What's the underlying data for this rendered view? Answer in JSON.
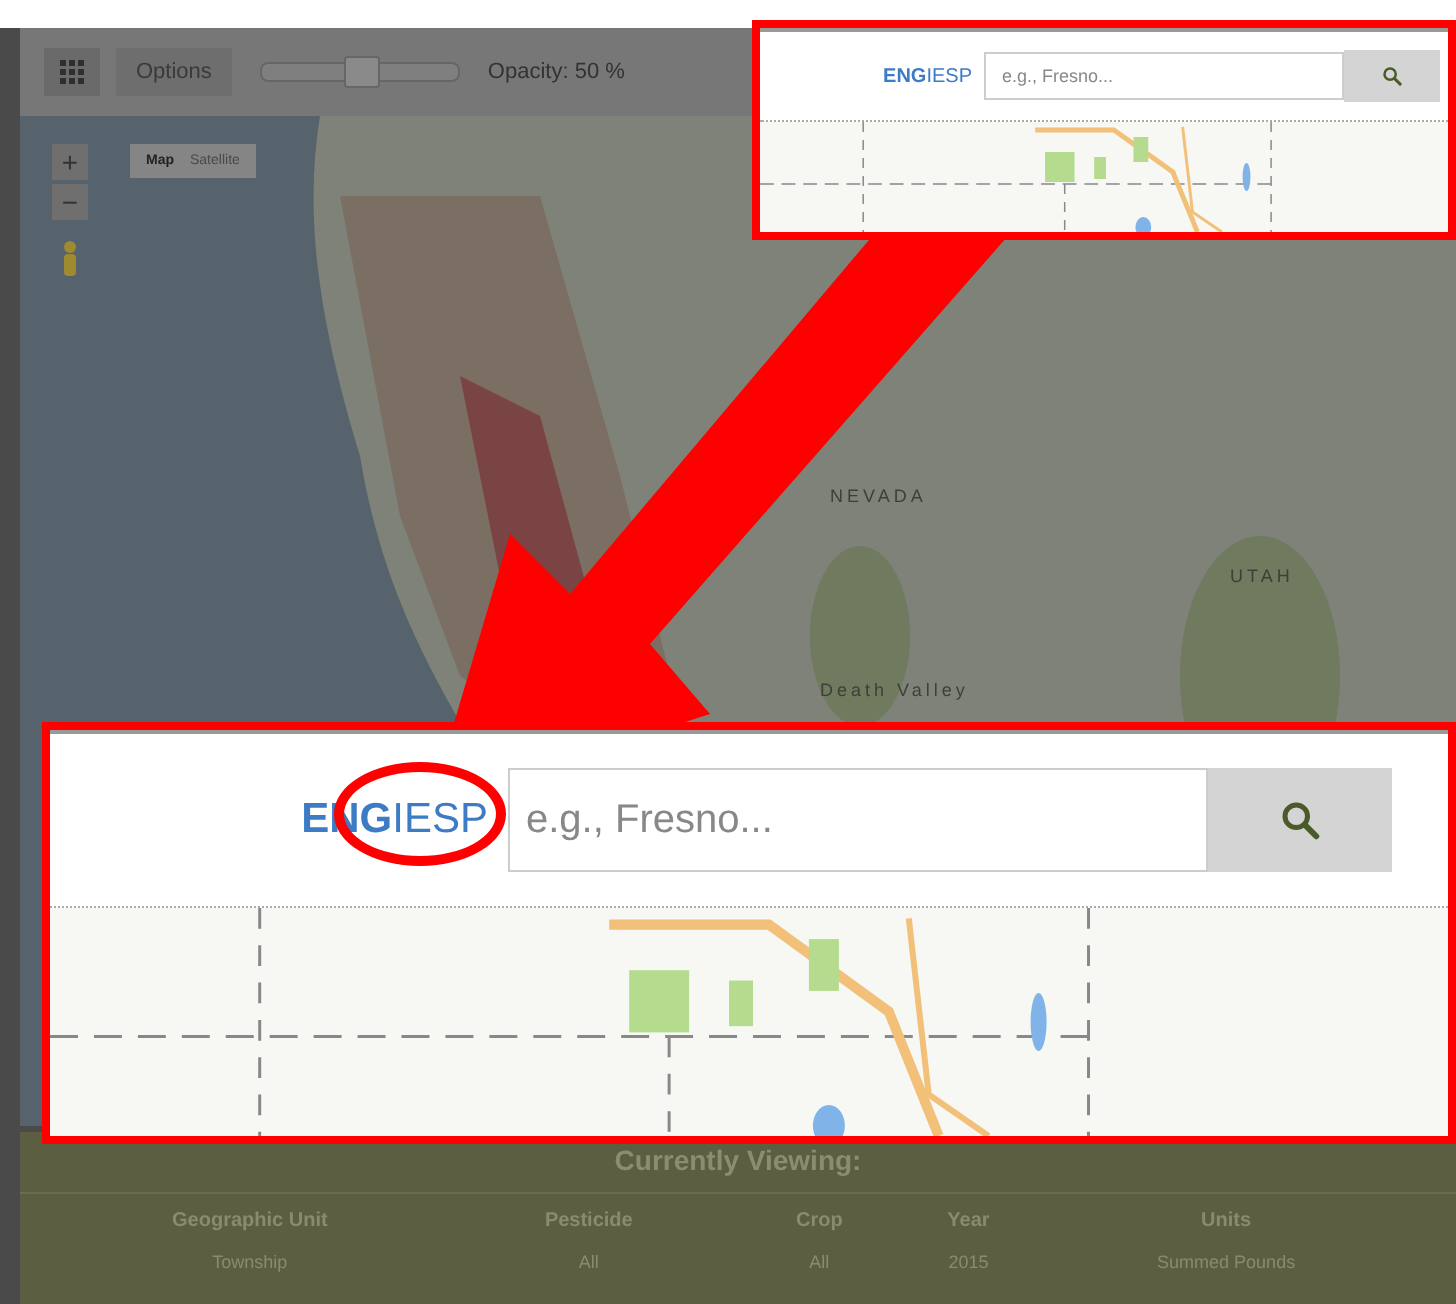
{
  "toolbar": {
    "options_button": "Options",
    "opacity_slider": {
      "level": 0.5
    },
    "opacity_label": "Opacity: 50 %"
  },
  "map": {
    "zoom_in": "+",
    "zoom_out": "−",
    "map_type_tabs": [
      {
        "label": "Map",
        "selected": true
      },
      {
        "label": "Satellite",
        "selected": false
      }
    ],
    "labels": [
      "NEVADA",
      "UTAH",
      "Death Valley"
    ]
  },
  "callouts": [
    {
      "brand": "**ENG**IESP",
      "search": {
        "placeholder": "e.g., Fresno..."
      },
      "circled": false
    },
    {
      "brand": "**ENG**IESP",
      "search": {
        "placeholder": "e.g., Fresno..."
      },
      "circled": true
    }
  ],
  "currently_viewing": {
    "title": "Currently Viewing:",
    "columns": [
      "Geographic Unit",
      "Pesticide",
      "Crop",
      "Year",
      "Units"
    ],
    "rows": [
      [
        "Township",
        "All",
        "All",
        "2015",
        "Summed Pounds"
      ]
    ]
  }
}
